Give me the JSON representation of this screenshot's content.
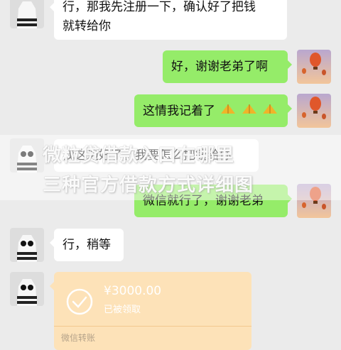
{
  "messages": [
    {
      "side": "left",
      "lines": [
        "行，那我先注册一下，确认好了把钱",
        "就转给你"
      ]
    },
    {
      "side": "right",
      "lines": [
        "好，谢谢老弟了啊"
      ]
    },
    {
      "side": "right",
      "lines": [
        "这情我记着了"
      ],
      "emoji": "praying-hands-icon ×3"
    },
    {
      "side": "left",
      "lines": [
        "我这边好了，我要怎么把钱给你"
      ]
    },
    {
      "side": "right",
      "lines": [
        "微信就行了，谢谢老弟"
      ]
    },
    {
      "side": "left",
      "lines": [
        "行，稍等"
      ]
    }
  ],
  "transfer": {
    "amount": "¥3000.00",
    "status": "已被领取",
    "footer": "微信转账",
    "color": "#fde2b8"
  },
  "watermark": {
    "line1": "微粒贷借款入口在哪里",
    "line2": "三种官方借款方式详细图"
  },
  "colors": {
    "bubble_right": "#95ec69",
    "bubble_left": "#ffffff",
    "background": "#ebebeb"
  }
}
